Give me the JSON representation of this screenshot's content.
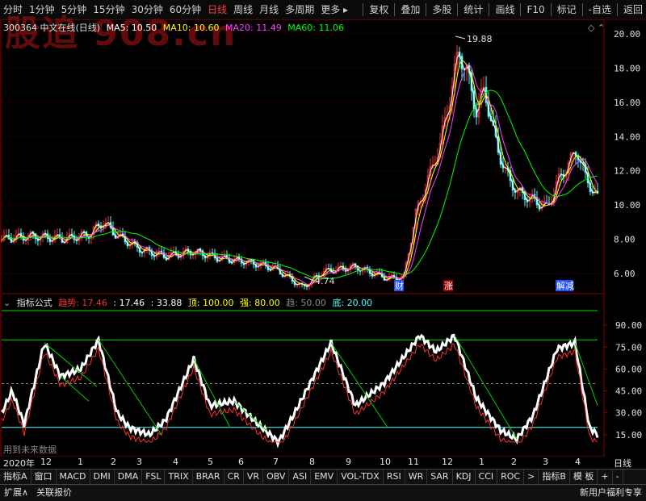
{
  "toolbar": {
    "left_items": [
      "分时",
      "1分钟",
      "5分钟",
      "15分钟",
      "30分钟",
      "60分钟",
      "日线",
      "周线",
      "月线",
      "多周期",
      "更多"
    ],
    "active_index": 6,
    "right_items": [
      "复权",
      "叠加",
      "多股",
      "统计",
      "画线",
      "F10",
      "标记",
      "-自选",
      "返回"
    ]
  },
  "watermark": "股追 908.cn",
  "stock": {
    "code_name": "300364 中文在线(日线)",
    "ma5": "MA5: 10.50",
    "ma10": "MA10: 10.60",
    "ma20": "MA20: 11.49",
    "ma60": "MA60: 11.06"
  },
  "colors": {
    "ma5": "#ffffff",
    "ma10": "#ffff00",
    "ma20": "#ff40ff",
    "ma60": "#00ff00",
    "up": "#ff3030",
    "down": "#54ffff",
    "grid": "#8b0000"
  },
  "price_axis": [
    "20.00",
    "18.00",
    "16.00",
    "14.00",
    "12.00",
    "10.00",
    "8.00",
    "6.00"
  ],
  "annotations": {
    "high": "19.88",
    "low": "4.74"
  },
  "events": [
    "财",
    "涨",
    "解减"
  ],
  "indicator": {
    "name": "指标公式",
    "trend_label": "趋势: 17.46",
    "v2": ": 17.46",
    "v3": ": 33.88",
    "top": "顶: 100.00",
    "strong": "强: 80.00",
    "trend2": "趋: 50.00",
    "bottom": "底: 20.00",
    "axis": [
      "90.00",
      "75.00",
      "60.00",
      "45.00",
      "30.00",
      "15.00"
    ],
    "note": "用到未来数据"
  },
  "dates": [
    "2020年",
    "12",
    "1",
    "2",
    "3",
    "4",
    "5",
    "6",
    "7",
    "8",
    "9",
    "10",
    "11",
    "12",
    "1",
    "2",
    "3",
    "4"
  ],
  "period_label": "日线",
  "tabs": [
    "指标A",
    "窗口",
    "MACD",
    "DMI",
    "DMA",
    "FSL",
    "TRIX",
    "BRAR",
    "CR",
    "VR",
    "OBV",
    "ASI",
    "EMV",
    "VOL-TDX",
    "RSI",
    "WR",
    "SAR",
    "KDJ",
    "CCI",
    "ROC",
    ">",
    "指标B",
    "模 板",
    "+",
    "-"
  ],
  "statusbar": {
    "left": [
      "扩展∧",
      "关联报价"
    ],
    "right": "新用户福利专享"
  }
}
